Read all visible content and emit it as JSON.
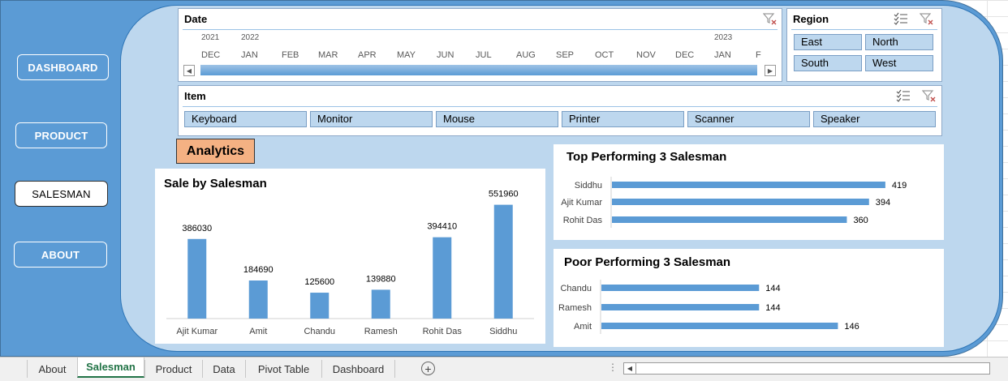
{
  "nav": {
    "dashboard": "DASHBOARD",
    "product": "PRODUCT",
    "salesman": "SALESMAN",
    "about": "ABOUT"
  },
  "date_slicer": {
    "title": "Date",
    "years": [
      "2021",
      "2022",
      "2023"
    ],
    "months": [
      "DEC",
      "JAN",
      "FEB",
      "MAR",
      "APR",
      "MAY",
      "JUN",
      "JUL",
      "AUG",
      "SEP",
      "OCT",
      "NOV",
      "DEC",
      "JAN",
      "F"
    ]
  },
  "region_slicer": {
    "title": "Region",
    "items": [
      "East",
      "North",
      "South",
      "West"
    ]
  },
  "item_slicer": {
    "title": "Item",
    "items": [
      "Keyboard",
      "Monitor",
      "Mouse",
      "Printer",
      "Scanner",
      "Speaker"
    ]
  },
  "analytics_label": "Analytics",
  "chart_data": [
    {
      "type": "bar",
      "title": "Sale by Salesman",
      "categories": [
        "Ajit Kumar",
        "Amit",
        "Chandu",
        "Ramesh",
        "Rohit Das",
        "Siddhu"
      ],
      "values": [
        386030,
        184690,
        125600,
        139880,
        394410,
        551960
      ],
      "ylim": [
        0,
        600000
      ],
      "grid": false,
      "legend": "none",
      "color": "#5b9bd5"
    },
    {
      "type": "bar",
      "orientation": "horizontal",
      "title": "Top Performing 3 Salesman",
      "categories": [
        "Siddhu",
        "Ajit Kumar",
        "Rohit Das"
      ],
      "values": [
        419,
        394,
        360
      ],
      "xlim": [
        0,
        500
      ],
      "grid": false,
      "legend": "none",
      "color": "#5b9bd5"
    },
    {
      "type": "bar",
      "orientation": "horizontal",
      "title": "Poor Performing 3 Salesman",
      "categories": [
        "Chandu",
        "Ramesh",
        "Amit"
      ],
      "values": [
        144,
        144,
        146
      ],
      "xlim": [
        140,
        147
      ],
      "grid": false,
      "legend": "none",
      "color": "#5b9bd5"
    }
  ],
  "sheet_tabs": [
    "About",
    "Salesman",
    "Product",
    "Data",
    "Pivot Table",
    "Dashboard"
  ],
  "active_tab": "Salesman",
  "colors": {
    "frame": "#5b9bd5",
    "panel": "#bdd7ee",
    "analytics": "#f4b183",
    "active_tab": "#217346"
  }
}
